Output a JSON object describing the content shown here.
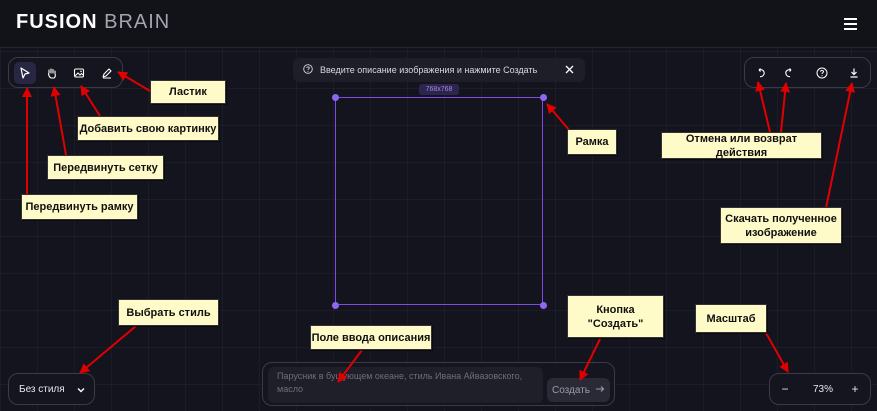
{
  "header": {
    "logo_bold": "FUSION",
    "logo_light": "BRAIN",
    "menu_icon": "hamburger-icon"
  },
  "toolbar_left": {
    "tools": [
      {
        "name": "cursor-icon",
        "active": true
      },
      {
        "name": "hand-icon",
        "active": false
      },
      {
        "name": "image-add-icon",
        "active": false
      },
      {
        "name": "eraser-icon",
        "active": false
      }
    ]
  },
  "toolbar_right": {
    "tools": [
      "undo-icon",
      "redo-icon",
      "help-icon",
      "download-icon"
    ]
  },
  "hint": {
    "text": "Введите описание изображения и нажмите Создать",
    "icon": "question-icon",
    "close_icon": "close-icon"
  },
  "canvas": {
    "size_label": "768x768"
  },
  "style_select": {
    "value": "Без стиля",
    "icon": "chevron-down-icon"
  },
  "prompt": {
    "placeholder": "Парусник в бушующем океане, стиль Ивана Айвазовского, масло",
    "create_label": "Создать",
    "create_icon": "arrow-right-icon"
  },
  "zoom": {
    "minus": "−",
    "plus": "+",
    "value": "73%"
  },
  "annotations": {
    "eraser": "Ластик",
    "add_image": "Добавить свою картинку",
    "move_grid": "Передвинуть сетку",
    "move_frame": "Передвинуть рамку",
    "frame": "Рамка",
    "undo_redo": "Отмена или возврат действия",
    "download": "Скачать полученное изображение",
    "choose_style": "Выбрать стиль",
    "prompt_field": "Поле ввода описания",
    "create_button": "Кнопка \"Создать\"",
    "zoom": "Масштаб"
  },
  "colors": {
    "background": "#14141f",
    "accent": "#8e66f0",
    "callout": "#fffbc8",
    "arrow": "#e00000"
  }
}
